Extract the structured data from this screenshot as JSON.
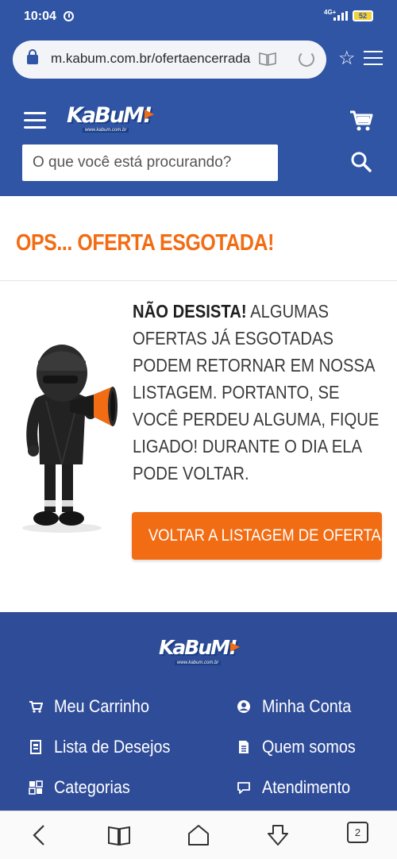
{
  "status": {
    "time": "10:04",
    "network": "4G+",
    "battery": "52"
  },
  "browser": {
    "url": "m.kabum.com.br/ofertaencerrada",
    "tab_count": "2"
  },
  "header": {
    "logo_text": "KaBuM!",
    "logo_subtext": "www.kabum.com.br",
    "search_placeholder": "O que você está procurando?"
  },
  "main": {
    "title": "OPS... OFERTA ESGOTADA!",
    "message_bold": "NÃO DESISTA!",
    "message_rest": " ALGUMAS OFERTAS JÁ ESGOTADAS PODEM RETORNAR EM NOSSA LISTAGEM. PORTANTO, SE VOCÊ PERDEU ALGUMA, FIQUE LIGADO! DURANTE O DIA ELA PODE VOLTAR.",
    "back_button": "VOLTAR A LISTAGEM DE OFERTAS"
  },
  "footer": {
    "logo_text": "KaBuM!",
    "logo_subtext": "www.kabum.com.br",
    "links": [
      {
        "label": "Meu Carrinho",
        "icon": "cart-icon"
      },
      {
        "label": "Minha Conta",
        "icon": "user-circle-icon"
      },
      {
        "label": "Lista de Desejos",
        "icon": "wishlist-icon"
      },
      {
        "label": "Quem somos",
        "icon": "document-icon"
      },
      {
        "label": "Categorias",
        "icon": "categories-grid-icon"
      },
      {
        "label": "Atendimento",
        "icon": "chat-bubble-icon"
      }
    ]
  },
  "colors": {
    "brand_blue": "#2f55a4",
    "footer_blue": "#2f4c98",
    "accent_orange": "#f26c13"
  }
}
